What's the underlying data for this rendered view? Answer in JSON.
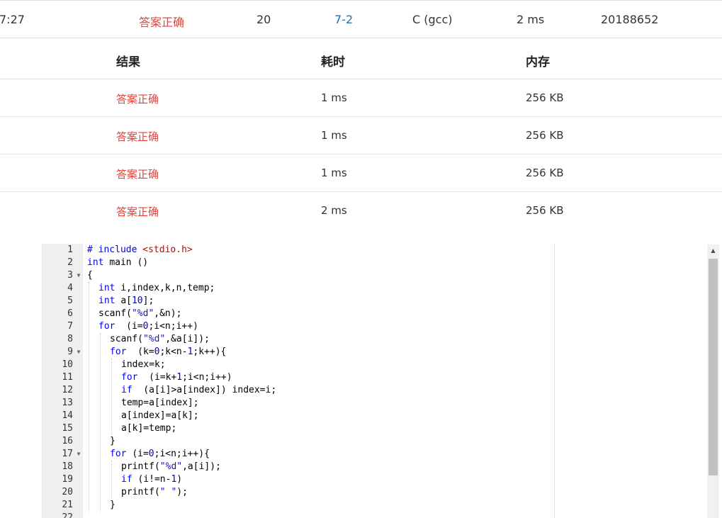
{
  "submission": {
    "time": "7:27",
    "status": "答案正确",
    "score": "20",
    "problem": "7-2",
    "compiler": "C (gcc)",
    "duration": "2 ms",
    "user": "20188652"
  },
  "cases": {
    "headers": {
      "result": "结果",
      "time": "耗时",
      "memory": "内存"
    },
    "rows": [
      {
        "result": "答案正确",
        "time": "1 ms",
        "memory": "256 KB"
      },
      {
        "result": "答案正确",
        "time": "1 ms",
        "memory": "256 KB"
      },
      {
        "result": "答案正确",
        "time": "1 ms",
        "memory": "256 KB"
      },
      {
        "result": "答案正确",
        "time": "2 ms",
        "memory": "256 KB"
      }
    ]
  },
  "code": {
    "lines": [
      {
        "n": "1",
        "fold": "",
        "indent": 0,
        "tokens": [
          [
            "kw",
            "# include "
          ],
          [
            "hdr",
            "<stdio.h>"
          ]
        ]
      },
      {
        "n": "2",
        "fold": "",
        "indent": 0,
        "tokens": [
          [
            "kw",
            "int"
          ],
          [
            "",
            "main ()"
          ]
        ]
      },
      {
        "n": "3",
        "fold": "▼",
        "indent": 0,
        "tokens": [
          [
            "",
            "{"
          ]
        ]
      },
      {
        "n": "4",
        "fold": "",
        "indent": 1,
        "tokens": [
          [
            "kw",
            "int"
          ],
          [
            "",
            "i,index,k,n,temp;"
          ]
        ]
      },
      {
        "n": "5",
        "fold": "",
        "indent": 1,
        "tokens": [
          [
            "kw",
            "int"
          ],
          [
            "",
            "a["
          ],
          [
            "num",
            "10"
          ],
          [
            "",
            "];"
          ]
        ]
      },
      {
        "n": "6",
        "fold": "",
        "indent": 1,
        "tokens": [
          [
            "",
            "scanf("
          ],
          [
            "str",
            "\"%d\""
          ],
          [
            "",
            ",&n);"
          ]
        ]
      },
      {
        "n": "7",
        "fold": "",
        "indent": 1,
        "tokens": [
          [
            "kw",
            "for"
          ],
          [
            "",
            " (i="
          ],
          [
            "num",
            "0"
          ],
          [
            "",
            ";i<n;i++)"
          ]
        ]
      },
      {
        "n": "8",
        "fold": "",
        "indent": 2,
        "tokens": [
          [
            "",
            "scanf("
          ],
          [
            "str",
            "\"%d\""
          ],
          [
            "",
            ",&a[i]);"
          ]
        ]
      },
      {
        "n": "9",
        "fold": "▼",
        "indent": 2,
        "tokens": [
          [
            "kw",
            "for"
          ],
          [
            "",
            " (k="
          ],
          [
            "num",
            "0"
          ],
          [
            "",
            ";k<n-"
          ],
          [
            "num",
            "1"
          ],
          [
            "",
            ";k++){"
          ]
        ]
      },
      {
        "n": "10",
        "fold": "",
        "indent": 3,
        "tokens": [
          [
            "",
            "index=k;"
          ]
        ]
      },
      {
        "n": "11",
        "fold": "",
        "indent": 3,
        "tokens": [
          [
            "kw",
            "for"
          ],
          [
            "",
            " (i=k+"
          ],
          [
            "num",
            "1"
          ],
          [
            "",
            ";i<n;i++)"
          ]
        ]
      },
      {
        "n": "12",
        "fold": "",
        "indent": 3,
        "tokens": [
          [
            "kw",
            "if"
          ],
          [
            "",
            " (a[i]>a[index]) index=i;"
          ]
        ]
      },
      {
        "n": "13",
        "fold": "",
        "indent": 3,
        "tokens": [
          [
            "",
            "temp=a[index];"
          ]
        ]
      },
      {
        "n": "14",
        "fold": "",
        "indent": 3,
        "tokens": [
          [
            "",
            "a[index]=a[k];"
          ]
        ]
      },
      {
        "n": "15",
        "fold": "",
        "indent": 3,
        "tokens": [
          [
            "",
            "a[k]=temp;"
          ]
        ]
      },
      {
        "n": "16",
        "fold": "",
        "indent": 2,
        "tokens": [
          [
            "",
            "}"
          ]
        ]
      },
      {
        "n": "17",
        "fold": "▼",
        "indent": 2,
        "tokens": [
          [
            "kw",
            "for"
          ],
          [
            "",
            "(i="
          ],
          [
            "num",
            "0"
          ],
          [
            "",
            ";i<n;i++){"
          ]
        ]
      },
      {
        "n": "18",
        "fold": "",
        "indent": 3,
        "tokens": [
          [
            "",
            "printf("
          ],
          [
            "str",
            "\"%d\""
          ],
          [
            "",
            ",a[i]);"
          ]
        ]
      },
      {
        "n": "19",
        "fold": "",
        "indent": 3,
        "tokens": [
          [
            "kw",
            "if"
          ],
          [
            "",
            "(i!=n-"
          ],
          [
            "num",
            "1"
          ],
          [
            "",
            ")"
          ]
        ]
      },
      {
        "n": "20",
        "fold": "",
        "indent": 3,
        "tokens": [
          [
            "",
            "printf("
          ],
          [
            "str",
            "\" \""
          ],
          [
            "",
            ");"
          ]
        ]
      },
      {
        "n": "21",
        "fold": "",
        "indent": 2,
        "tokens": [
          [
            "",
            "}"
          ]
        ]
      },
      {
        "n": "22",
        "fold": "",
        "indent": 0,
        "tokens": []
      }
    ]
  }
}
